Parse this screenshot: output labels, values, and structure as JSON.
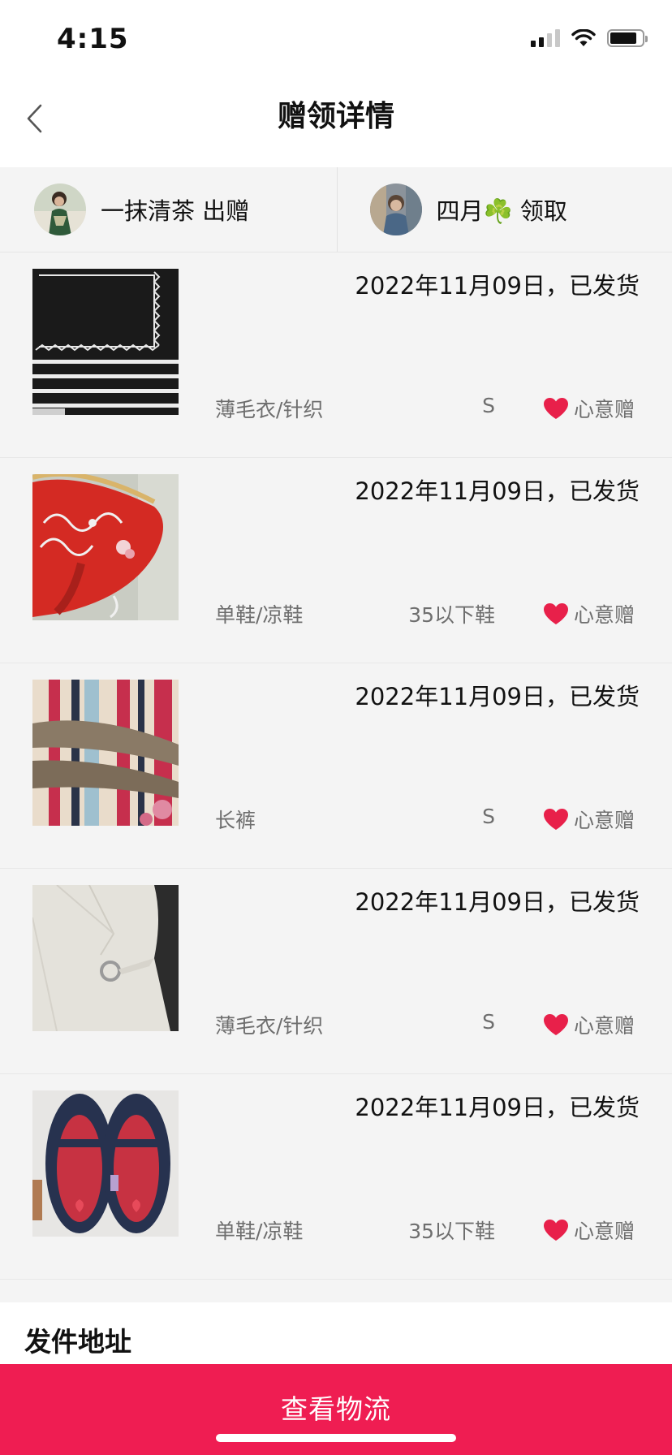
{
  "status_bar": {
    "time": "4:15"
  },
  "nav": {
    "title": "赠领详情"
  },
  "giver": {
    "name": "一抹清茶",
    "action": "出赠"
  },
  "receiver": {
    "name": "四月☘️",
    "action": "领取"
  },
  "items": [
    {
      "status": "2022年11月09日，已发货",
      "category": "薄毛衣/针织",
      "size": "S",
      "gift_type": "心意赠",
      "image": "black-white-striped-sweater"
    },
    {
      "status": "2022年11月09日，已发货",
      "category": "单鞋/凉鞋",
      "size": "35以下鞋",
      "gift_type": "心意赠",
      "image": "red-embroidered-shoe"
    },
    {
      "status": "2022年11月09日，已发货",
      "category": "长裤",
      "size": "S",
      "gift_type": "心意赠",
      "image": "taupe-trousers"
    },
    {
      "status": "2022年11月09日，已发货",
      "category": "薄毛衣/针织",
      "size": "S",
      "gift_type": "心意赠",
      "image": "white-knit-cardigan"
    },
    {
      "status": "2022年11月09日，已发货",
      "category": "单鞋/凉鞋",
      "size": "35以下鞋",
      "gift_type": "心意赠",
      "image": "navy-kids-shoes"
    }
  ],
  "address_section": {
    "title": "发件地址"
  },
  "bottom_button": {
    "label": "查看物流"
  },
  "colors": {
    "accent": "#ef1d52",
    "heart": "#e8204a",
    "background": "#f4f4f4"
  }
}
